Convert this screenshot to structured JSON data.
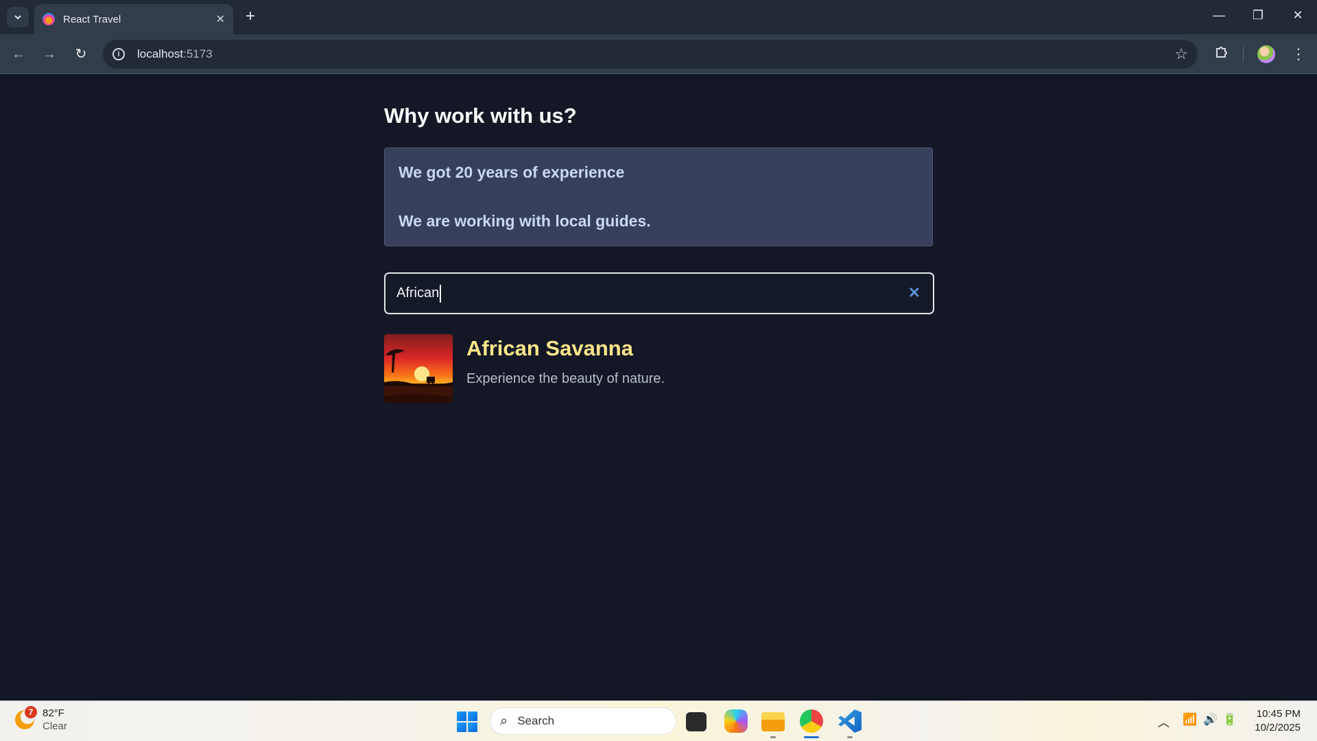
{
  "browser": {
    "tab_title": "React Travel",
    "url_host": "localhost",
    "url_port": ":5173"
  },
  "page": {
    "heading": "Why work with us?",
    "reasons": [
      "We got 20 years of experience",
      "We are working with local guides."
    ],
    "search": {
      "value": "African"
    },
    "results": [
      {
        "name": "African Savanna",
        "description": "Experience the beauty of nature."
      }
    ]
  },
  "taskbar": {
    "weather": {
      "temp": "82°F",
      "condition": "Clear",
      "badge": "7"
    },
    "search_placeholder": "Search",
    "time": "10:45 PM",
    "date": "10/2/2025"
  },
  "colors": {
    "page_bg": "#141826",
    "panel_bg": "#383f5a",
    "result_title": "#fde68a",
    "reason_text": "#c7d8f4"
  }
}
